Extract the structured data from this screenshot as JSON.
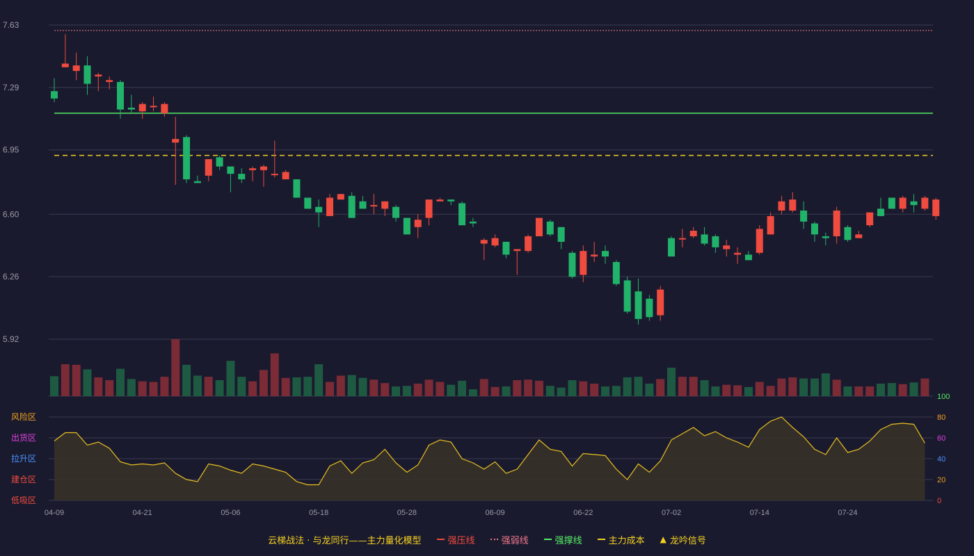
{
  "colors": {
    "background": "#1a1a2e",
    "up": "#ef4b3f",
    "down": "#22b36b",
    "up_volume": "#7a2b36",
    "down_volume": "#1e5a42",
    "resistance": "#ef4b3f",
    "weak_line": "#f0798a",
    "support": "#55ee66",
    "cost": "#f5d020",
    "oscillator": "#e8c020",
    "grid": "#3a3a52",
    "axis_text": "#9a9aa6"
  },
  "chart_data": {
    "type": "candlestick",
    "x_tick_labels": [
      "04-09",
      "04-21",
      "05-06",
      "05-18",
      "05-28",
      "06-09",
      "06-22",
      "07-02",
      "07-14",
      "07-24"
    ],
    "x_tick_index": [
      0,
      8,
      16,
      24,
      32,
      40,
      48,
      56,
      64,
      72
    ],
    "price_axis": {
      "ticks": [
        "7.63",
        "7.29",
        "6.95",
        "6.60",
        "6.26",
        "5.92"
      ],
      "ylim": [
        5.92,
        7.63
      ]
    },
    "volume_axis": {
      "ticks": [
        "100"
      ],
      "ylim": [
        0,
        100
      ]
    },
    "oscillator_axis": {
      "ticks": [
        "80",
        "60",
        "40",
        "20",
        "0"
      ],
      "ylim": [
        0,
        80
      ]
    },
    "zone_labels": [
      {
        "text": "风险区",
        "color": "#f0a020"
      },
      {
        "text": "出货区",
        "color": "#e040e0"
      },
      {
        "text": "拉升区",
        "color": "#4a90ff"
      },
      {
        "text": "建仓区",
        "color": "#ef4b3f"
      },
      {
        "text": "低吸区",
        "color": "#ef4b3f"
      }
    ],
    "lines": {
      "strong_resistance": 6.91,
      "weak_line": 7.6,
      "strong_support": 7.15,
      "main_cost": 6.92
    },
    "candles": [
      [
        7.27,
        7.23,
        7.34,
        7.21
      ],
      [
        7.4,
        7.42,
        7.58,
        7.4
      ],
      [
        7.38,
        7.41,
        7.48,
        7.33
      ],
      [
        7.41,
        7.31,
        7.46,
        7.25
      ],
      [
        7.35,
        7.36,
        7.37,
        7.27
      ],
      [
        7.32,
        7.33,
        7.35,
        7.28
      ],
      [
        7.32,
        7.17,
        7.33,
        7.12
      ],
      [
        7.18,
        7.17,
        7.25,
        7.15
      ],
      [
        7.16,
        7.2,
        7.21,
        7.12
      ],
      [
        7.19,
        7.19,
        7.24,
        7.16
      ],
      [
        7.15,
        7.2,
        7.21,
        7.13
      ],
      [
        6.99,
        7.01,
        7.13,
        6.76
      ],
      [
        7.02,
        6.79,
        7.03,
        6.77
      ],
      [
        6.78,
        6.77,
        6.81,
        6.77
      ],
      [
        6.81,
        6.9,
        6.9,
        6.78
      ],
      [
        6.91,
        6.86,
        6.92,
        6.84
      ],
      [
        6.86,
        6.82,
        6.84,
        6.72
      ],
      [
        6.82,
        6.79,
        6.85,
        6.77
      ],
      [
        6.84,
        6.85,
        6.86,
        6.78
      ],
      [
        6.84,
        6.86,
        6.87,
        6.75
      ],
      [
        6.82,
        6.82,
        7.0,
        6.8
      ],
      [
        6.79,
        6.83,
        6.84,
        6.79
      ],
      [
        6.79,
        6.69,
        6.79,
        6.69
      ],
      [
        6.69,
        6.63,
        6.69,
        6.63
      ],
      [
        6.64,
        6.61,
        6.68,
        6.53
      ],
      [
        6.59,
        6.69,
        6.71,
        6.62
      ],
      [
        6.68,
        6.71,
        6.71,
        6.68
      ],
      [
        6.7,
        6.58,
        6.72,
        6.58
      ],
      [
        6.67,
        6.63,
        6.7,
        6.63
      ],
      [
        6.65,
        6.65,
        6.71,
        6.6
      ],
      [
        6.63,
        6.67,
        6.67,
        6.59
      ],
      [
        6.64,
        6.58,
        6.65,
        6.56
      ],
      [
        6.58,
        6.49,
        6.58,
        6.49
      ],
      [
        6.53,
        6.57,
        6.6,
        6.47
      ],
      [
        6.58,
        6.68,
        6.68,
        6.54
      ],
      [
        6.67,
        6.68,
        6.69,
        6.68
      ],
      [
        6.68,
        6.67,
        6.68,
        6.65
      ],
      [
        6.66,
        6.54,
        6.67,
        6.54
      ],
      [
        6.56,
        6.55,
        6.58,
        6.53
      ],
      [
        6.44,
        6.46,
        6.47,
        6.35
      ],
      [
        6.43,
        6.47,
        6.49,
        6.42
      ],
      [
        6.45,
        6.38,
        6.45,
        6.36
      ],
      [
        6.4,
        6.41,
        6.41,
        6.27
      ],
      [
        6.4,
        6.48,
        6.49,
        6.39
      ],
      [
        6.48,
        6.58,
        6.58,
        6.48
      ],
      [
        6.56,
        6.49,
        6.57,
        6.48
      ],
      [
        6.53,
        6.45,
        6.53,
        6.41
      ],
      [
        6.39,
        6.26,
        6.4,
        6.25
      ],
      [
        6.27,
        6.4,
        6.43,
        6.23
      ],
      [
        6.37,
        6.38,
        6.45,
        6.34
      ],
      [
        6.4,
        6.37,
        6.43,
        6.33
      ],
      [
        6.34,
        6.22,
        6.35,
        6.21
      ],
      [
        6.24,
        6.07,
        6.26,
        6.06
      ],
      [
        6.18,
        6.03,
        6.25,
        6.0
      ],
      [
        6.14,
        6.04,
        6.16,
        6.02
      ],
      [
        6.05,
        6.19,
        6.21,
        6.02
      ],
      [
        6.47,
        6.37,
        6.48,
        6.37
      ],
      [
        6.47,
        6.47,
        6.52,
        6.42
      ],
      [
        6.48,
        6.51,
        6.53,
        6.47
      ],
      [
        6.49,
        6.44,
        6.53,
        6.43
      ],
      [
        6.48,
        6.42,
        6.49,
        6.39
      ],
      [
        6.41,
        6.43,
        6.46,
        6.37
      ],
      [
        6.38,
        6.39,
        6.42,
        6.33
      ],
      [
        6.38,
        6.35,
        6.4,
        6.36
      ],
      [
        6.39,
        6.52,
        6.54,
        6.38
      ],
      [
        6.49,
        6.59,
        6.61,
        6.49
      ],
      [
        6.62,
        6.67,
        6.7,
        6.6
      ],
      [
        6.62,
        6.68,
        6.72,
        6.61
      ],
      [
        6.62,
        6.56,
        6.67,
        6.52
      ],
      [
        6.55,
        6.49,
        6.56,
        6.45
      ],
      [
        6.48,
        6.47,
        6.5,
        6.43
      ],
      [
        6.48,
        6.62,
        6.64,
        6.44
      ],
      [
        6.53,
        6.46,
        6.54,
        6.45
      ],
      [
        6.47,
        6.49,
        6.51,
        6.47
      ],
      [
        6.54,
        6.61,
        6.61,
        6.53
      ],
      [
        6.63,
        6.59,
        6.69,
        6.59
      ],
      [
        6.69,
        6.63,
        6.69,
        6.63
      ],
      [
        6.63,
        6.69,
        6.7,
        6.61
      ],
      [
        6.67,
        6.65,
        6.71,
        6.61
      ],
      [
        6.63,
        6.69,
        6.7,
        6.62
      ],
      [
        6.59,
        6.68,
        6.69,
        6.57
      ]
    ],
    "volume": [
      35,
      56,
      55,
      47,
      33,
      28,
      48,
      30,
      26,
      25,
      34,
      100,
      55,
      36,
      34,
      28,
      62,
      34,
      26,
      46,
      75,
      32,
      33,
      34,
      56,
      25,
      36,
      37,
      32,
      29,
      23,
      17,
      18,
      22,
      29,
      25,
      20,
      27,
      12,
      30,
      16,
      17,
      28,
      29,
      27,
      18,
      15,
      28,
      26,
      22,
      17,
      18,
      33,
      34,
      22,
      30,
      50,
      34,
      34,
      28,
      17,
      20,
      19,
      16,
      25,
      18,
      31,
      33,
      31,
      31,
      40,
      29,
      17,
      17,
      17,
      22,
      23,
      21,
      24,
      31
    ],
    "oscillator": [
      57,
      65,
      65,
      53,
      56,
      50,
      37,
      34,
      35,
      34,
      36,
      26,
      20,
      18,
      35,
      33,
      29,
      26,
      35,
      33,
      30,
      27,
      18,
      15,
      15,
      33,
      38,
      26,
      36,
      39,
      49,
      36,
      27,
      34,
      53,
      58,
      56,
      40,
      36,
      30,
      37,
      26,
      30,
      44,
      58,
      49,
      47,
      33,
      45,
      44,
      43,
      30,
      20,
      35,
      27,
      38,
      58,
      64,
      70,
      62,
      66,
      60,
      56,
      51,
      68,
      76,
      80,
      70,
      61,
      49,
      44,
      60,
      46,
      49,
      57,
      68,
      73,
      74,
      73,
      55
    ]
  },
  "legend": {
    "title": "云梯战法 · 与龙同行——主力量化模型",
    "items": [
      {
        "label": "强压线",
        "color": "#ef4b3f",
        "style": "solid"
      },
      {
        "label": "强弱线",
        "color": "#f0798a",
        "style": "dotted"
      },
      {
        "label": "强撑线",
        "color": "#55ee66",
        "style": "solid"
      },
      {
        "label": "主力成本",
        "color": "#f5d020",
        "style": "dashed"
      },
      {
        "label": "龙吟信号",
        "color": "#f5d020",
        "style": "triangle"
      }
    ]
  }
}
